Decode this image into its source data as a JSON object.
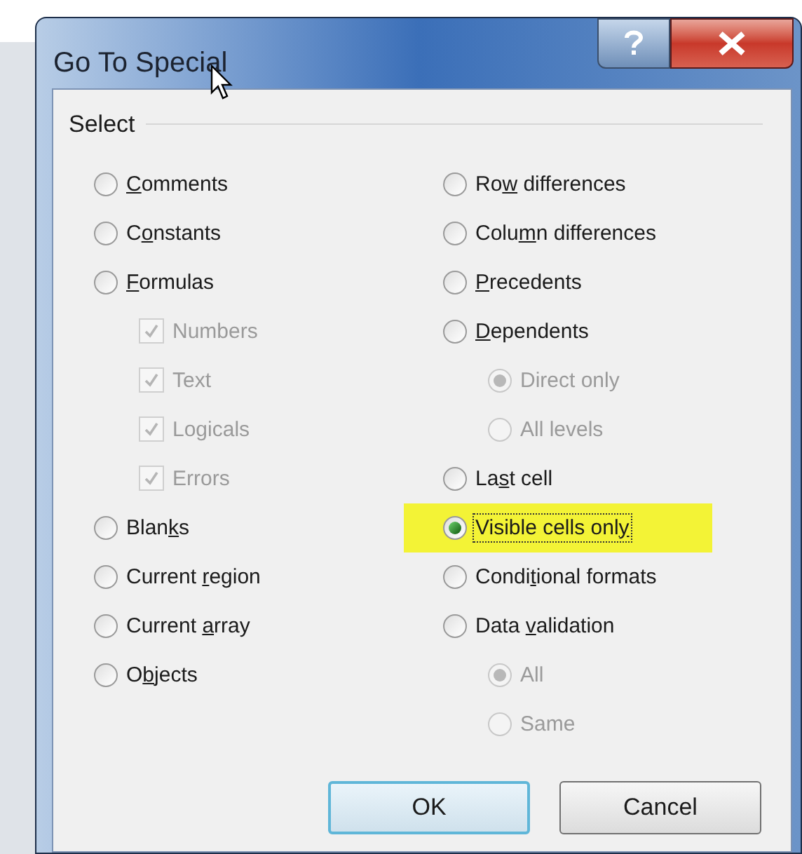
{
  "window": {
    "title": "Go To Special"
  },
  "select_group": {
    "title": "Select",
    "columns": [
      [
        {
          "kind": "radio",
          "access_key": "C",
          "label_after": "omments",
          "selected": false,
          "disabled": false
        },
        {
          "kind": "radio",
          "label_before": "C",
          "access_key": "o",
          "label_after": "nstants",
          "selected": false,
          "disabled": false
        },
        {
          "kind": "radio",
          "access_key": "F",
          "label_after": "ormulas",
          "selected": false,
          "disabled": false,
          "children": [
            {
              "kind": "checkbox",
              "label_before": "Numbers",
              "checked": true,
              "disabled": true
            },
            {
              "kind": "checkbox",
              "label_before": "Text",
              "checked": true,
              "disabled": true
            },
            {
              "kind": "checkbox",
              "label_before": "Logicals",
              "checked": true,
              "disabled": true
            },
            {
              "kind": "checkbox",
              "label_before": "Errors",
              "checked": true,
              "disabled": true
            }
          ]
        },
        {
          "kind": "radio",
          "label_before": "Blan",
          "access_key": "k",
          "label_after": "s",
          "selected": false,
          "disabled": false
        },
        {
          "kind": "radio",
          "label_before": "Current ",
          "access_key": "r",
          "label_after": "egion",
          "selected": false,
          "disabled": false
        },
        {
          "kind": "radio",
          "label_before": "Current ",
          "access_key": "a",
          "label_after": "rray",
          "selected": false,
          "disabled": false
        },
        {
          "kind": "radio",
          "label_before": "O",
          "access_key": "b",
          "label_after": "jects",
          "selected": false,
          "disabled": false
        }
      ],
      [
        {
          "kind": "radio",
          "label_before": "Ro",
          "access_key": "w",
          "label_after": " differences",
          "selected": false,
          "disabled": false
        },
        {
          "kind": "radio",
          "label_before": "Colu",
          "access_key": "m",
          "label_after": "n differences",
          "selected": false,
          "disabled": false
        },
        {
          "kind": "radio",
          "access_key": "P",
          "label_after": "recedents",
          "selected": false,
          "disabled": false
        },
        {
          "kind": "radio",
          "access_key": "D",
          "label_after": "ependents",
          "selected": false,
          "disabled": false,
          "children": [
            {
              "kind": "radio",
              "label_before": "Direct only",
              "selected": true,
              "disabled": true
            },
            {
              "kind": "radio",
              "label_before": "All levels",
              "selected": false,
              "disabled": true
            }
          ]
        },
        {
          "kind": "radio",
          "label_before": "La",
          "access_key": "s",
          "label_after": "t cell",
          "selected": false,
          "disabled": false
        },
        {
          "kind": "radio",
          "label_before": "Visible cells onl",
          "access_key": "y",
          "selected": true,
          "disabled": false,
          "highlighted": true,
          "focused": true
        },
        {
          "kind": "radio",
          "label_before": "Condi",
          "access_key": "t",
          "label_after": "ional formats",
          "selected": false,
          "disabled": false
        },
        {
          "kind": "radio",
          "label_before": "Data ",
          "access_key": "v",
          "label_after": "alidation",
          "selected": false,
          "disabled": false,
          "children": [
            {
              "kind": "radio",
              "label_before": "All",
              "selected": true,
              "disabled": true
            },
            {
              "kind": "radio",
              "label_before": "Same",
              "selected": false,
              "disabled": true
            }
          ]
        }
      ]
    ]
  },
  "buttons": [
    {
      "label": "OK",
      "default": true
    },
    {
      "label": "Cancel",
      "default": false
    }
  ]
}
